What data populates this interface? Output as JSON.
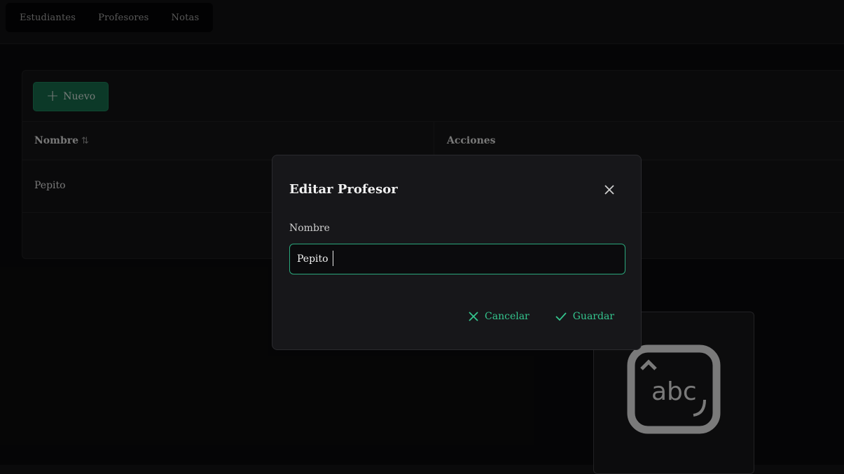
{
  "nav": {
    "items": [
      "Estudiantes",
      "Profesores",
      "Notas"
    ]
  },
  "toolbar": {
    "new_label": "Nuevo"
  },
  "table": {
    "headers": {
      "name": "Nombre",
      "actions": "Acciones"
    },
    "rows": [
      {
        "name": "Pepito"
      }
    ]
  },
  "dialog": {
    "title": "Editar Profesor",
    "field_label": "Nombre",
    "field_value": "Pepito",
    "cancel_label": "Cancelar",
    "save_label": "Guardar"
  },
  "keyboard_widget": {
    "text": "abc"
  },
  "colors": {
    "background": "#0a0a0b",
    "accent": "#34c58e",
    "primary_button": "#17704f",
    "dialog_bg": "#17171a"
  }
}
